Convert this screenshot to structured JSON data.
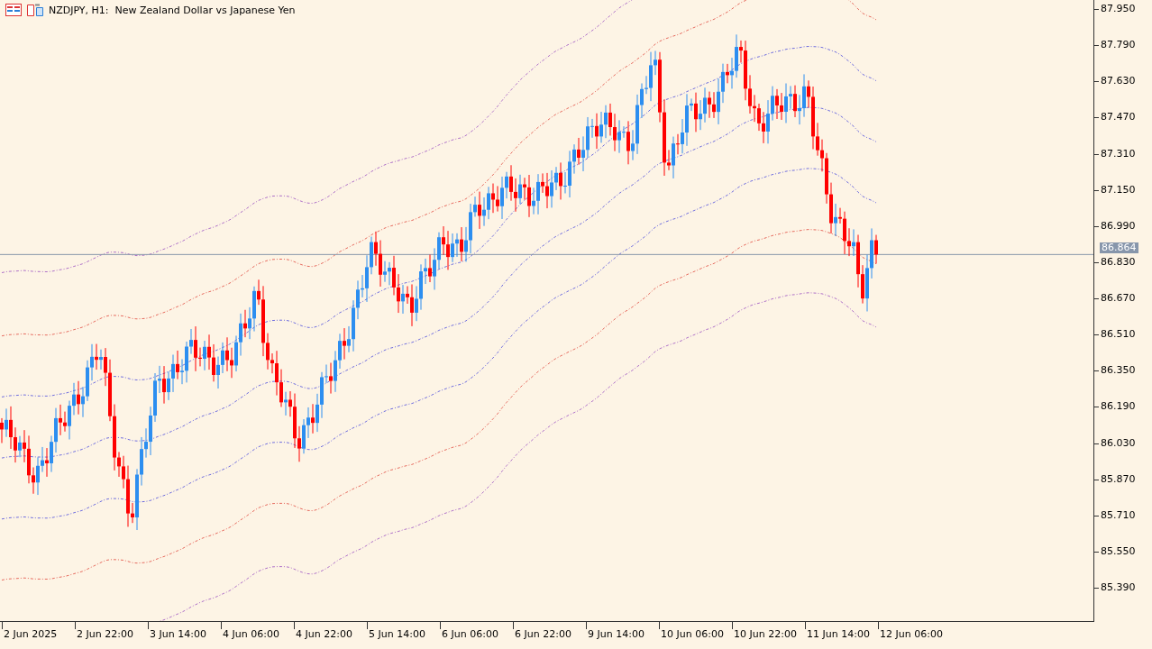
{
  "chart_title": "NZDJPY, H1:  New Zealand Dollar vs Japanese Yen",
  "price_axis": [
    "87.950",
    "87.790",
    "87.630",
    "87.470",
    "87.310",
    "87.150",
    "86.990",
    "86.830",
    "86.670",
    "86.510",
    "86.350",
    "86.190",
    "86.030",
    "85.870",
    "85.710",
    "85.550",
    "85.390"
  ],
  "current_price": "86.864",
  "time_axis": [
    "2 Jun 2025",
    "2 Jun 22:00",
    "3 Jun 14:00",
    "4 Jun 06:00",
    "4 Jun 22:00",
    "5 Jun 14:00",
    "6 Jun 06:00",
    "6 Jun 22:00",
    "9 Jun 14:00",
    "10 Jun 06:00",
    "10 Jun 22:00",
    "11 Jun 14:00",
    "12 Jun 06:00"
  ]
}
